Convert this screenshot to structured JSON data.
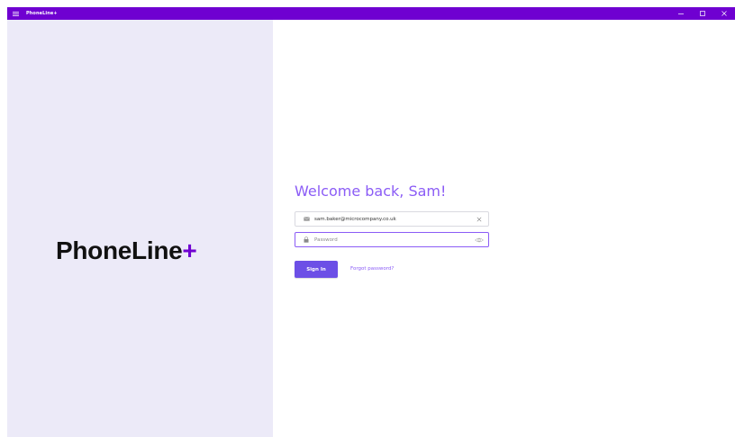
{
  "window": {
    "title": "PhoneLine+",
    "menu_icon": "hamburger-icon",
    "controls": [
      "minimize-icon",
      "maximize-icon",
      "close-icon"
    ],
    "accent_color": "#6f00d1"
  },
  "brand": {
    "logo_text": "PhoneLine",
    "logo_plus": "+",
    "panel_color": "#eceaf8",
    "text_color": "#111111",
    "plus_color": "#6f00d1"
  },
  "login": {
    "welcome_text": "Welcome back, Sam!",
    "email": {
      "value": "sam.baker@microcompany.co.uk",
      "icon": "mail-icon",
      "clear_icon": "clear-icon"
    },
    "password": {
      "value": "",
      "placeholder": "Password",
      "icon": "lock-icon",
      "reveal_icon": "eye-icon"
    },
    "sign_in_label": "Sign In",
    "forgot_password_label": "Forgot password?",
    "primary_color": "#6c4fe6",
    "link_color": "#8b5cf6"
  }
}
